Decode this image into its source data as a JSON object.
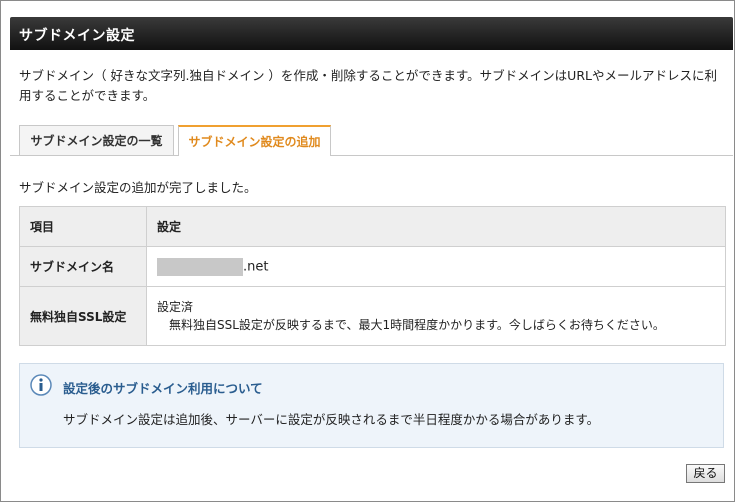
{
  "header": {
    "title": "サブドメイン設定"
  },
  "description": "サブドメイン（ 好きな文字列.独自ドメイン ）を作成・削除することができます。サブドメインはURLやメールアドレスに利用することができます。",
  "tabs": [
    {
      "label": "サブドメイン設定の一覧",
      "active": false
    },
    {
      "label": "サブドメイン設定の追加",
      "active": true
    }
  ],
  "done_message": "サブドメイン設定の追加が完了しました。",
  "table": {
    "headers": [
      "項目",
      "設定"
    ],
    "rows": [
      {
        "label": "サブドメイン名",
        "domain_suffix": ".net"
      },
      {
        "label": "無料独自SSL設定",
        "status": "設定済",
        "note": "無料独自SSL設定が反映するまで、最大1時間程度かかります。今しばらくお待ちください。"
      }
    ]
  },
  "notice": {
    "icon": "info-icon",
    "title": "設定後のサブドメイン利用について",
    "body": "サブドメイン設定は追加後、サーバーに設定が反映されるまで半日程度かかる場合があります。"
  },
  "buttons": {
    "back_label": "戻る"
  },
  "colors": {
    "header_bg": "#1c1c1c",
    "active_tab": "#e08a1e",
    "notice_bg": "#eef4fa",
    "notice_title": "#2a5d8f"
  }
}
